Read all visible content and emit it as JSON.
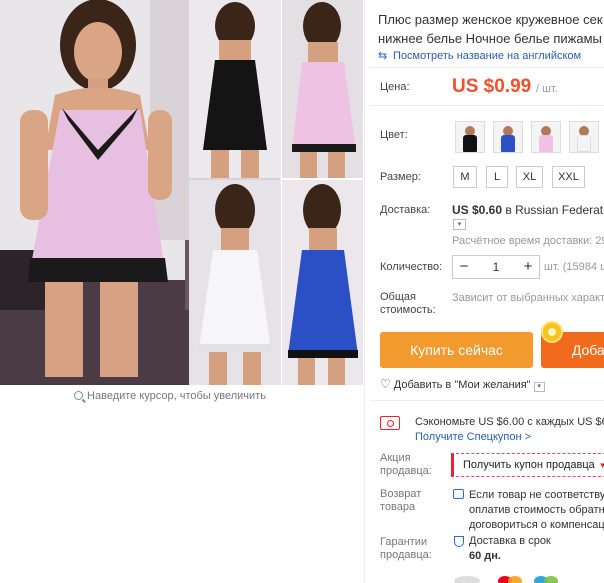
{
  "gallery": {
    "zoom_hint": "Наведите курсор, чтобы увеличить",
    "photos": [
      {
        "name": "main",
        "dress_color": "#e7bfe0",
        "lace_color": "#1a1a1a"
      },
      {
        "name": "black",
        "dress_color": "#141414",
        "lace_color": "#050505"
      },
      {
        "name": "pink",
        "dress_color": "#efc2e3",
        "lace_color": "#1a1a1a"
      },
      {
        "name": "white",
        "dress_color": "#f6f6f8",
        "lace_color": "#e9e9e9"
      },
      {
        "name": "blue",
        "dress_color": "#2b4fc4",
        "lace_color": "#111111"
      }
    ]
  },
  "product": {
    "title_line1": "Плюс размер женское кружевное сек",
    "title_line2": "нижнее белье Ночное белье пижамы",
    "translate_link": "Посмотреть название на английском"
  },
  "price": {
    "label": "Цена:",
    "value": "US $0.99",
    "unit": "/ шт."
  },
  "color": {
    "label": "Цвет:",
    "swatches": [
      {
        "dress": "#111111"
      },
      {
        "dress": "#2b4fc4"
      },
      {
        "dress": "#efc2e3"
      },
      {
        "dress": "#f4f4f6"
      }
    ]
  },
  "size": {
    "label": "Размер:",
    "options": [
      "M",
      "L",
      "XL",
      "XXL"
    ]
  },
  "shipping": {
    "label": "Доставка:",
    "price": "US $0.60",
    "carrier_prefix": " в ",
    "carrier": "Russian Federation",
    "estimate": "Расчётное время доставки: 29-"
  },
  "quantity": {
    "label": "Количество:",
    "value": "1",
    "unit": "шт. (15984 ш"
  },
  "total": {
    "label_line1": "Общая",
    "label_line2": "стоимость:",
    "value": "Зависит от выбранных характе"
  },
  "actions": {
    "buy_now": "Купить сейчас",
    "add_to_cart": "Добав",
    "wishlist": "Добавить в \"Мои желания\""
  },
  "coupon": {
    "save_text": "Сэкономьте US $6.00 с каждых US $65.0",
    "get_link": "Получите Спецкупон >"
  },
  "seller_promo": {
    "label_line1": "Акция",
    "label_line2": "продавца:",
    "button": "Получить купон продавца"
  },
  "returns": {
    "label_line1": "Возврат",
    "label_line2": "товара",
    "text_line1": "Если товар не соответствует",
    "text_line2": "оплатив стоимость обратно",
    "text_line3": "договориться о компенсаци"
  },
  "guarantee": {
    "label_line1": "Гарантии",
    "label_line2": "продавца:",
    "text": "Доставка в срок",
    "days": "60 дн."
  },
  "colors": {
    "price_red": "#f0502d",
    "buy_orange": "#f39a2f",
    "cart_orange": "#f26a1b",
    "link_blue": "#2a5fb0"
  }
}
